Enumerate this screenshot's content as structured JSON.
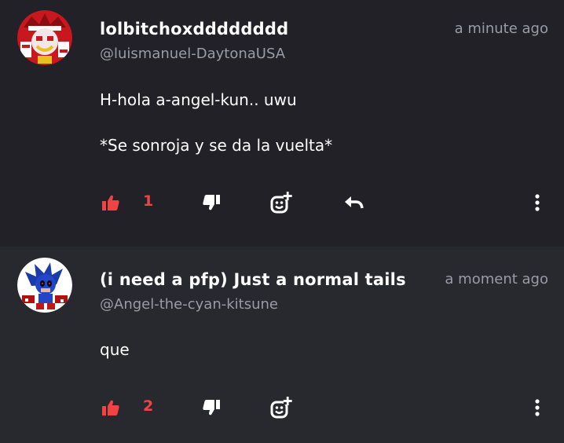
{
  "comments": [
    {
      "username": "lolbitchoxdddddddd",
      "handle": "@luismanuel-DaytonaUSA",
      "timestamp": "a minute ago",
      "body_lines": [
        "H-hola a-angel-kun.. uwu",
        "*Se sonroja y se da la vuelta*"
      ],
      "likes": "1",
      "icons": {
        "like": "thumbs-up-icon",
        "dislike": "thumbs-down-icon",
        "react": "add-reaction-icon",
        "reply": "reply-arrow-icon",
        "more": "vertical-ellipsis-icon"
      }
    },
    {
      "username": "(i need a pfp) Just a normal tails",
      "handle": "@Angel-the-cyan-kitsune",
      "timestamp": "a moment ago",
      "body_lines": [
        "que"
      ],
      "likes": "2",
      "icons": {
        "like": "thumbs-up-icon",
        "dislike": "thumbs-down-icon",
        "react": "add-reaction-icon",
        "more": "vertical-ellipsis-icon"
      }
    }
  ],
  "colors": {
    "like_active": "#f04444",
    "text_primary": "#ffffff",
    "text_muted": "#9b9ba6",
    "bg_comment_1": "#212127",
    "bg_comment_2": "#28282f"
  }
}
